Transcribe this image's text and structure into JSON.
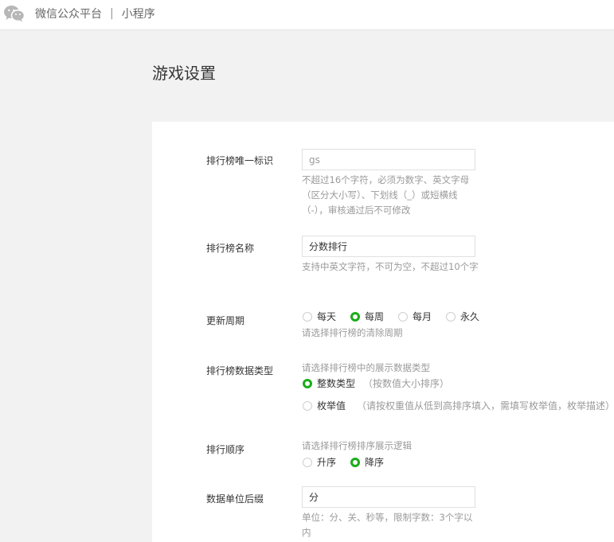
{
  "header": {
    "brand": "微信公众平台",
    "separator": "|",
    "product": "小程序"
  },
  "page": {
    "title": "游戏设置"
  },
  "form": {
    "rank_id": {
      "label": "排行榜唯一标识",
      "value": "",
      "placeholder": "gs",
      "hint": "不超过16个字符，必须为数字、英文字母（区分大小写）、下划线（_）或短横线（-），审核通过后不可修改"
    },
    "rank_name": {
      "label": "排行榜名称",
      "value": "分数排行",
      "hint": "支持中英文字符，不可为空，不超过10个字"
    },
    "cycle": {
      "label": "更新周期",
      "options": [
        "每天",
        "每周",
        "每月",
        "永久"
      ],
      "selected": "每周",
      "hint": "请选择排行榜的清除周期"
    },
    "data_type": {
      "label": "排行榜数据类型",
      "hint": "请选择排行榜中的展示数据类型",
      "options": [
        {
          "label": "整数类型",
          "desc": "（按数值大小排序）",
          "selected": true
        },
        {
          "label": "枚举值",
          "desc": "（请按权重值从低到高排序填入，需填写枚举值，枚举描述）",
          "selected": false
        }
      ]
    },
    "order": {
      "label": "排行顺序",
      "hint": "请选择排行榜排序展示逻辑",
      "options": [
        "升序",
        "降序"
      ],
      "selected": "降序"
    },
    "unit_suffix": {
      "label": "数据单位后缀",
      "value": "分",
      "hint": "单位：分、关、秒等，限制字数：3个字以内"
    }
  },
  "colors": {
    "accent": "#1aad19",
    "hint": "#9a9a9a"
  }
}
